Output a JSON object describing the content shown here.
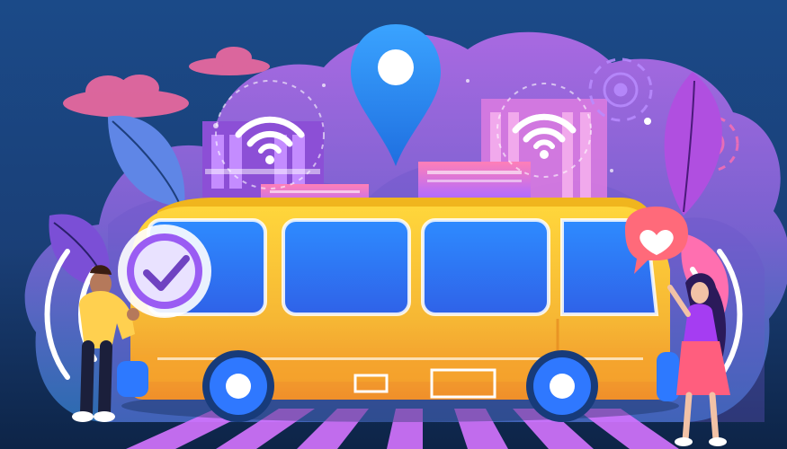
{
  "scene": {
    "palette": {
      "bg_top": "#1f4f86",
      "bg_bottom": "#0f2a4f",
      "purple_cloud": "#8a5ad6",
      "violet": "#a94fe0",
      "pink": "#f06aa0",
      "bus_yellow": "#f7c533",
      "bus_orange": "#f29a2c",
      "window_blue": "#2f8cff",
      "wheel_blue": "#1f6fe0",
      "white": "#ffffff"
    },
    "icons": [
      "location-pin-icon",
      "wifi-icon",
      "gear-icon",
      "check-badge-icon",
      "heart-speech-bubble-icon",
      "signal-wave-icon"
    ]
  }
}
